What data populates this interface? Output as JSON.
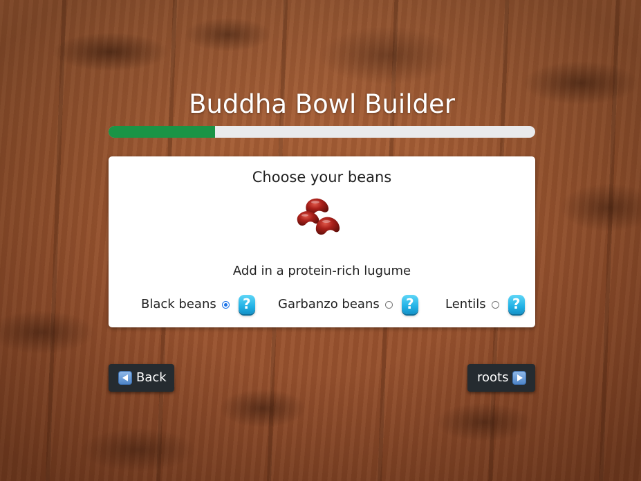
{
  "app": {
    "title": "Buddha Bowl Builder"
  },
  "progress": {
    "fraction": 0.25,
    "color": "#1a9446",
    "track_color": "#e9eaec"
  },
  "step": {
    "heading": "Choose your beans",
    "image_icon": "kidney-beans-icon",
    "subtitle": "Add in a protein-rich lugume",
    "options": [
      {
        "label": "Black beans",
        "selected": true,
        "help_icon": "question-mark-icon",
        "help_glyph": "?"
      },
      {
        "label": "Garbanzo beans",
        "selected": false,
        "help_icon": "question-mark-icon",
        "help_glyph": "?"
      },
      {
        "label": "Lentils",
        "selected": false,
        "help_icon": "question-mark-icon",
        "help_glyph": "?"
      }
    ]
  },
  "nav": {
    "back_label": "Back",
    "back_icon": "left-arrow-icon",
    "next_label": "roots",
    "next_icon": "right-arrow-icon"
  }
}
